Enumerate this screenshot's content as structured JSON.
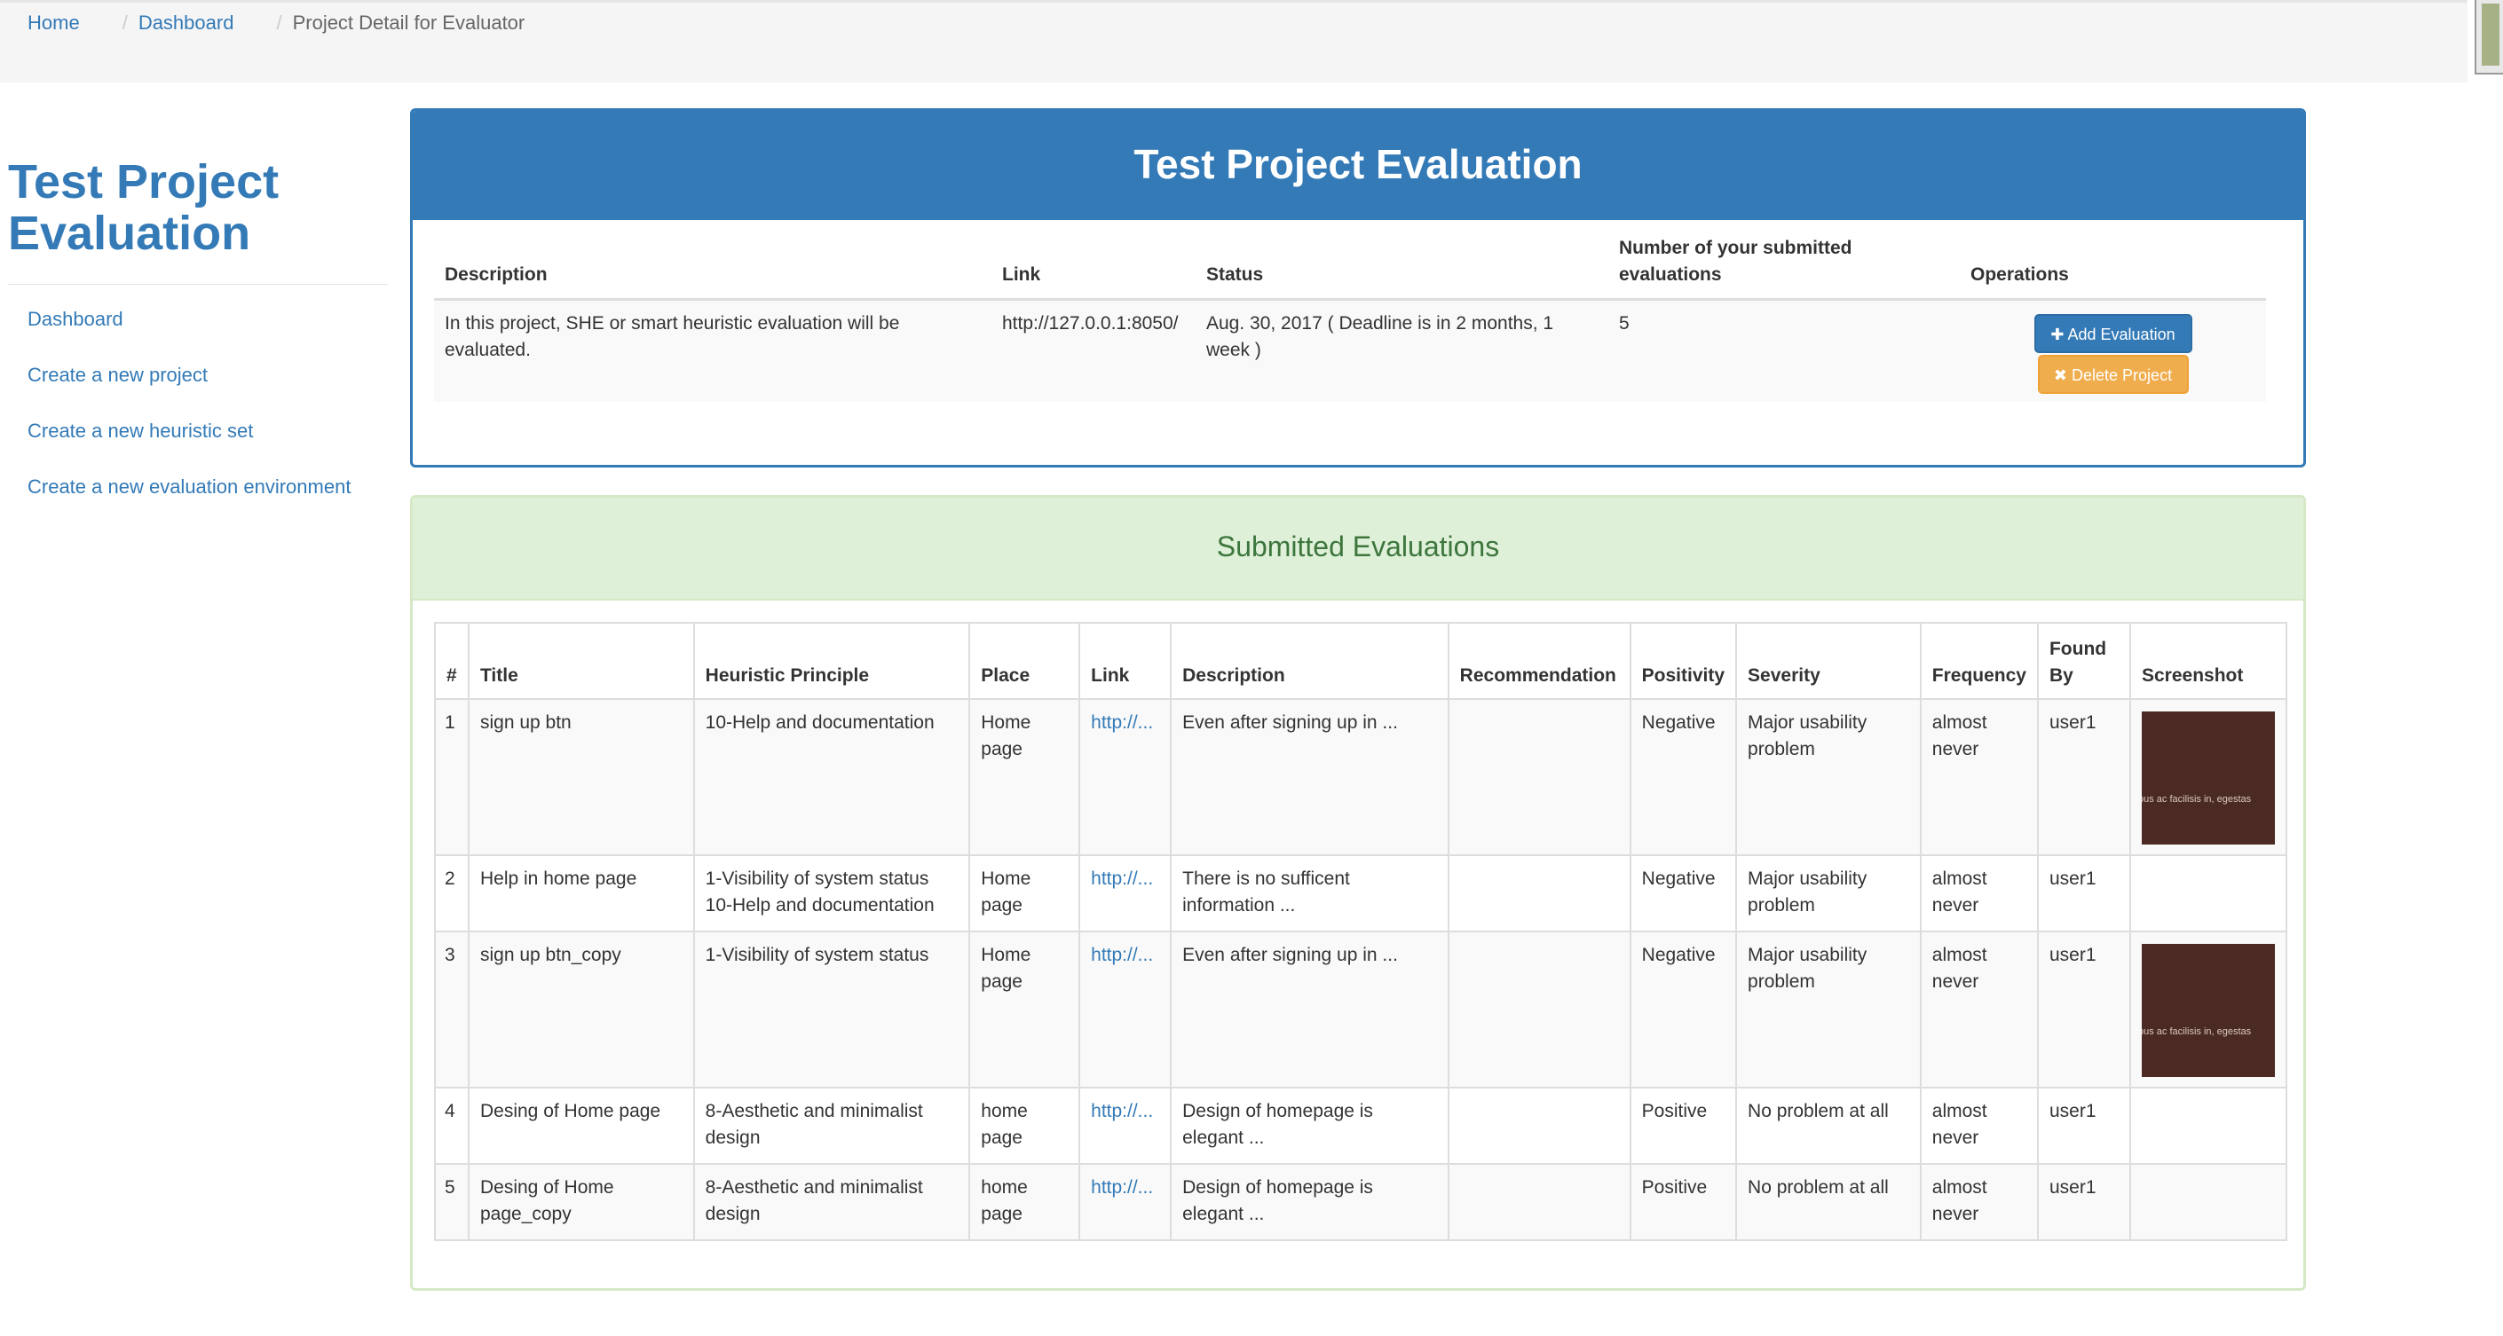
{
  "breadcrumb": {
    "items": [
      "Home",
      "Dashboard"
    ],
    "separator": "/",
    "current": "Project Detail for Evaluator"
  },
  "sidebar": {
    "title_line1": "Test Project",
    "title_line2": "Evaluation",
    "items": [
      {
        "label": "Dashboard"
      },
      {
        "label": "Create a new project"
      },
      {
        "label": "Create a new heuristic set"
      },
      {
        "label": "Create a new evaluation environment"
      }
    ]
  },
  "project_panel": {
    "title": "Test Project Evaluation",
    "headers": {
      "description": "Description",
      "link": "Link",
      "status": "Status",
      "submitted_line1": "Number of your submitted",
      "submitted_line2": "evaluations",
      "operations": "Operations"
    },
    "row": {
      "description": "In this project, SHE or smart heuristic evaluation will be evaluated.",
      "link": "http://127.0.0.1:8050/",
      "status": "Aug. 30, 2017 ( Deadline is in 2 months, 1 week )",
      "submitted": "5"
    },
    "add_button": "Add Evaluation",
    "delete_button": "Delete Project",
    "add_icon": "plus-icon",
    "delete_icon": "remove-icon"
  },
  "evaluations_panel": {
    "title": "Submitted Evaluations",
    "headers": {
      "num": "#",
      "title": "Title",
      "principle": "Heuristic Principle",
      "place": "Place",
      "link": "Link",
      "description": "Description",
      "recommendation": "Recommendation",
      "positivity": "Positivity",
      "severity": "Severity",
      "frequency": "Frequency",
      "found_by_line1": "Found",
      "found_by_line2": "By",
      "screenshot": "Screenshot"
    },
    "rows": [
      {
        "num": "1",
        "title": "sign up btn",
        "principle1": "10-Help and documentation",
        "principle2": "",
        "place": "Home page",
        "link": "http://...",
        "description": "Even after signing up in ...",
        "recommendation": "",
        "positivity": "Negative",
        "severity": "Major usability problem",
        "frequency": "almost never",
        "found_by": "user1",
        "screenshot_text": "bus ac facilisis in, egestas"
      },
      {
        "num": "2",
        "title": "Help in home page",
        "principle1": "1-Visibility of system status",
        "principle2": "10-Help and documentation",
        "place": "Home page",
        "link": "http://...",
        "description": "There is no sufficent information ...",
        "recommendation": "",
        "positivity": "Negative",
        "severity": "Major usability problem",
        "frequency": "almost never",
        "found_by": "user1",
        "screenshot_text": ""
      },
      {
        "num": "3",
        "title": "sign up btn_copy",
        "principle1": "1-Visibility of system status",
        "principle2": "",
        "place": "Home page",
        "link": "http://...",
        "description": "Even after signing up in ...",
        "recommendation": "",
        "positivity": "Negative",
        "severity": "Major usability problem",
        "frequency": "almost never",
        "found_by": "user1",
        "screenshot_text": "bus ac facilisis in, egestas"
      },
      {
        "num": "4",
        "title": "Desing of Home page",
        "principle1": "8-Aesthetic and minimalist design",
        "principle2": "",
        "place": "home page",
        "link": "http://...",
        "description": "Design of homepage is elegant ...",
        "recommendation": "",
        "positivity": "Positive",
        "severity": "No problem at all",
        "frequency": "almost never",
        "found_by": "user1",
        "screenshot_text": ""
      },
      {
        "num": "5",
        "title": "Desing of Home page_copy",
        "principle1": "8-Aesthetic and minimalist design",
        "principle2": "",
        "place": "home page",
        "link": "http://...",
        "description": "Design of homepage is elegant ...",
        "recommendation": "",
        "positivity": "Positive",
        "severity": "No problem at all",
        "frequency": "almost never",
        "found_by": "user1",
        "screenshot_text": ""
      }
    ]
  },
  "colors": {
    "primary": "#337ab7",
    "warning": "#f0ad4e",
    "success_bg": "#dff0d8",
    "success_text": "#3c763d"
  }
}
